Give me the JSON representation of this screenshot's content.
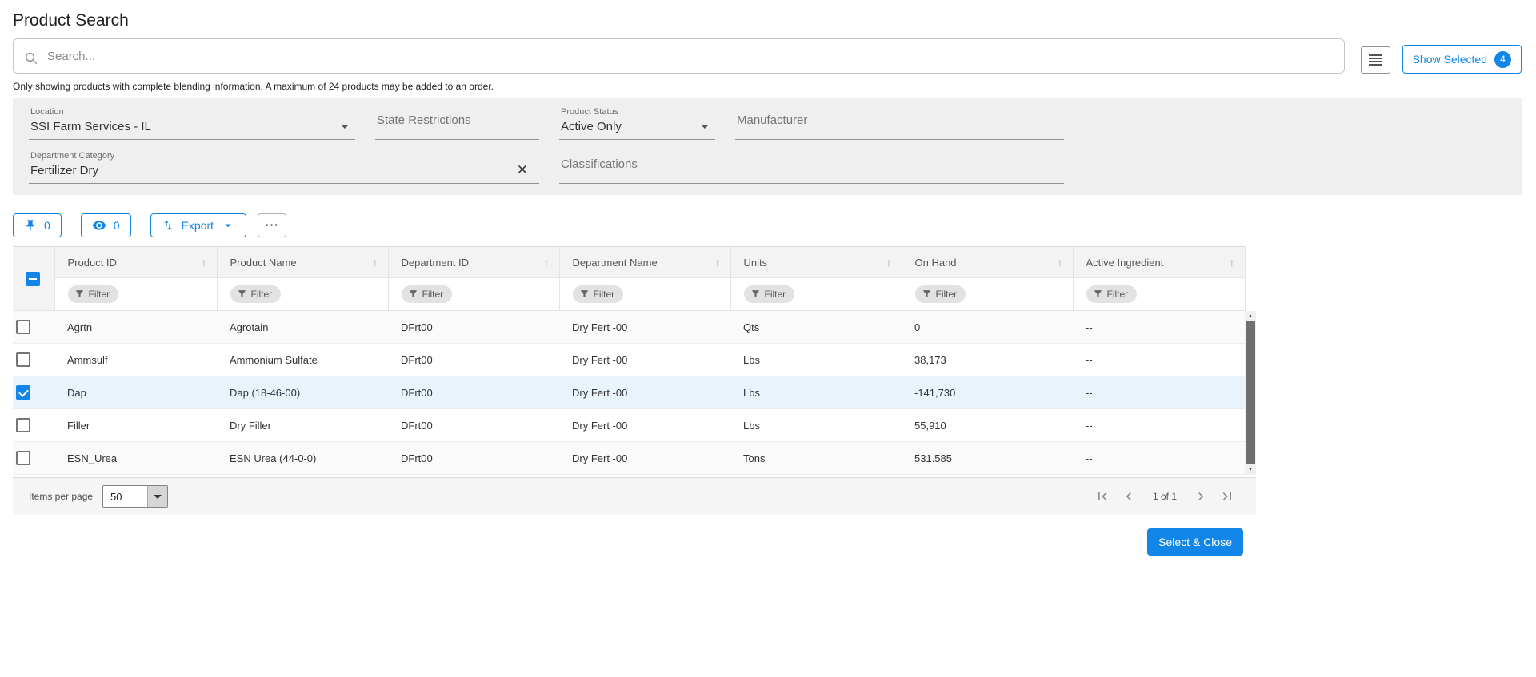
{
  "colors": {
    "primary": "#1285e8",
    "selected_row": "#e8f3fc"
  },
  "page": {
    "title": "Product Search"
  },
  "search": {
    "placeholder": "Search...",
    "show_selected_label": "Show Selected",
    "show_selected_count": "4"
  },
  "notice": "Only showing products with complete blending information. A maximum of 24 products may be added to an order.",
  "filters": {
    "location": {
      "label": "Location",
      "value": "SSI Farm Services - IL"
    },
    "state_restrictions": {
      "label": "State Restrictions",
      "value": ""
    },
    "product_status": {
      "label": "Product Status",
      "value": "Active Only"
    },
    "manufacturer": {
      "label": "Manufacturer",
      "value": ""
    },
    "department_category": {
      "label": "Department Category",
      "value": "Fertilizer Dry"
    },
    "classifications": {
      "label": "Classifications",
      "value": ""
    }
  },
  "toolbar": {
    "pinned_count": "0",
    "watch_count": "0",
    "export_label": "Export",
    "more_label": "⋯"
  },
  "table": {
    "columns": [
      "Product ID",
      "Product Name",
      "Department ID",
      "Department Name",
      "Units",
      "On Hand",
      "Active Ingredient"
    ],
    "filter_label": "Filter",
    "rows": [
      {
        "product_id": "Agrtn",
        "product_name": "Agrotain",
        "department_id": "DFrt00",
        "department_name": "Dry Fert -00",
        "units": "Qts",
        "on_hand": "0",
        "active_ingredient": "--",
        "checked": false
      },
      {
        "product_id": "Ammsulf",
        "product_name": "Ammonium Sulfate",
        "department_id": "DFrt00",
        "department_name": "Dry Fert -00",
        "units": "Lbs",
        "on_hand": "38,173",
        "active_ingredient": "--",
        "checked": false
      },
      {
        "product_id": "Dap",
        "product_name": "Dap (18-46-00)",
        "department_id": "DFrt00",
        "department_name": "Dry Fert -00",
        "units": "Lbs",
        "on_hand": "-141,730",
        "active_ingredient": "--",
        "checked": true
      },
      {
        "product_id": "Filler",
        "product_name": "Dry Filler",
        "department_id": "DFrt00",
        "department_name": "Dry Fert -00",
        "units": "Lbs",
        "on_hand": "55,910",
        "active_ingredient": "--",
        "checked": false
      },
      {
        "product_id": "ESN_Urea",
        "product_name": "ESN Urea (44-0-0)",
        "department_id": "DFrt00",
        "department_name": "Dry Fert -00",
        "units": "Tons",
        "on_hand": "531.585",
        "active_ingredient": "--",
        "checked": false
      }
    ]
  },
  "pagination": {
    "items_per_page_label": "Items per page",
    "items_per_page_value": "50",
    "page_info": "1 of 1"
  },
  "actions": {
    "select_close_label": "Select & Close"
  }
}
